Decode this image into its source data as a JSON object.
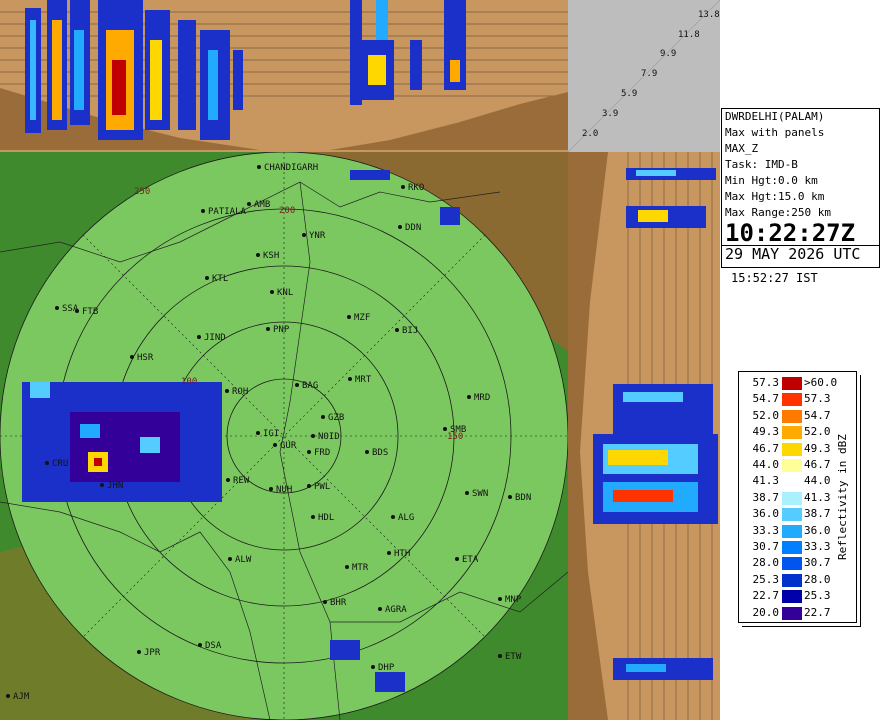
{
  "station": {
    "name": "DWRDELHI(PALAM)",
    "product": "Max with panels",
    "field": "MAX_Z",
    "task": "Task: IMD-B",
    "min_hgt": "Min Hgt:0.0 km",
    "max_hgt": "Max Hgt:15.0 km",
    "max_range": "Max Range:250 km"
  },
  "time": {
    "utc_time": "10:22:27Z",
    "utc_date": "29 MAY 2026 UTC",
    "ist": "15:52:27 IST"
  },
  "height_axis": [
    "13.8",
    "11.8",
    "9.9",
    "7.9",
    "5.9",
    "3.9",
    "2.0"
  ],
  "legend": {
    "title": "Reflectivity in dBZ",
    "rows": [
      {
        "min": "57.3",
        "max": ">60.0",
        "color": "#c00000"
      },
      {
        "min": "54.7",
        "max": "57.3",
        "color": "#ff3300"
      },
      {
        "min": "52.0",
        "max": "54.7",
        "color": "#ff7a00"
      },
      {
        "min": "49.3",
        "max": "52.0",
        "color": "#ffaa00"
      },
      {
        "min": "46.7",
        "max": "49.3",
        "color": "#ffd700"
      },
      {
        "min": "44.0",
        "max": "46.7",
        "color": "#ffff99"
      },
      {
        "min": "41.3",
        "max": "44.0",
        "color": "#ffffff"
      },
      {
        "min": "38.7",
        "max": "41.3",
        "color": "#aaf0ff"
      },
      {
        "min": "36.0",
        "max": "38.7",
        "color": "#55ccff"
      },
      {
        "min": "33.3",
        "max": "36.0",
        "color": "#22aaff"
      },
      {
        "min": "30.7",
        "max": "33.3",
        "color": "#0080ff"
      },
      {
        "min": "28.0",
        "max": "30.7",
        "color": "#0055ee"
      },
      {
        "min": "25.3",
        "max": "28.0",
        "color": "#0033cc"
      },
      {
        "min": "22.7",
        "max": "25.3",
        "color": "#0000aa"
      },
      {
        "min": "20.0",
        "max": "22.7",
        "color": "#330099"
      }
    ]
  },
  "range_labels": [
    "100",
    "150",
    "200",
    "250"
  ],
  "cities": {
    "chandigarh": "CHANDIGARH",
    "patiala": "PATIALA",
    "amb": "AMB",
    "dehradun": "DDN",
    "rko": "RKO",
    "ynr": "YNR",
    "ksh": "KSH",
    "ktl": "KTL",
    "knl": "KNL",
    "ftb": "FTB",
    "ssa": "SSA",
    "mzf": "MZF",
    "bij": "BIJ",
    "pnp": "PNP",
    "jind": "JIND",
    "hsr": "HSR",
    "meerut": "MRT",
    "bag": "BAG",
    "roh": "ROH",
    "mrd": "MRD",
    "ghaziabad": "GZB",
    "igi": "IGI",
    "noida": "NOID",
    "gurgaon": "GUR",
    "frd": "FRD",
    "bds": "BDS",
    "smb": "SMB",
    "rew": "REW",
    "pwl": "PWL",
    "nuh": "NUH",
    "swn": "SWN",
    "bdn": "BDN",
    "hdl": "HDL",
    "alg": "ALG",
    "cru": "CRU",
    "jhn": "JHN",
    "alw": "ALW",
    "hth": "HTH",
    "mtr": "MTR",
    "eta": "ETA",
    "bhr": "BHR",
    "agra": "AGRA",
    "mnp": "MNP",
    "jpr": "JPR",
    "dsa": "DSA",
    "etw": "ETW",
    "dhp": "DHP",
    "ajm": "AJM"
  },
  "colors": {
    "ground": "#c8975f",
    "terrain_low": "#3e8a2c",
    "range_disc": "#7cc860",
    "mountains": "#8a6a30"
  }
}
